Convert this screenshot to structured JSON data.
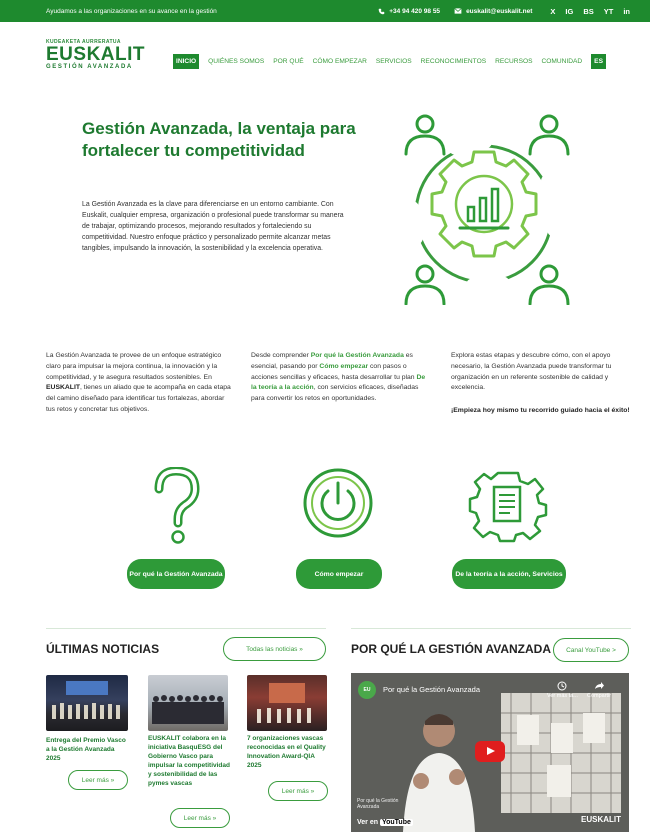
{
  "topbar": {
    "tagline": "Ayudamos a las organizaciones en su avance en la gestión",
    "phone": "+34 94 420 98 55",
    "email": "euskalit@euskalit.net",
    "socials": [
      "X",
      "IG",
      "BS",
      "YT",
      "in"
    ]
  },
  "logo": {
    "line1": "KUDEAKETA AURRERATUA",
    "line2": "EUSKALIT",
    "line3": "GESTIÓN AVANZADA"
  },
  "nav": {
    "items": [
      "INICIO",
      "QUIÉNES SOMOS",
      "POR QUÉ",
      "CÓMO EMPEZAR",
      "SERVICIOS",
      "RECONOCIMIENTOS",
      "RECURSOS",
      "COMUNIDAD"
    ],
    "lang": "ES"
  },
  "hero": {
    "title": "Gestión Avanzada, la ventaja para fortalecer tu competitividad",
    "text": "La Gestión Avanzada es la clave para diferenciarse en un entorno cambiante. Con Euskalit, cualquier empresa, organización o profesional puede transformar su manera de trabajar, optimizando procesos, mejorando resultados y fortaleciendo su competitividad. Nuestro enfoque práctico y personalizado permite alcanzar metas tangibles, impulsando la innovación, la sostenibilidad y la excelencia operativa."
  },
  "columns": {
    "c1_a": "La Gestión Avanzada te provee de un enfoque estratégico claro para impulsar la mejora continua, la innovación y la competitividad, y te asegura resultados sostenibles. En ",
    "c1_b": "EUSKALIT",
    "c1_c": ", tienes un aliado que te acompaña en cada etapa del camino diseñado para identificar tus fortalezas, abordar tus retos y concretar tus objetivos.",
    "c2_a": "Desde comprender ",
    "c2_b": "Por qué la Gestión Avanzada",
    "c2_c": " es esencial, pasando por ",
    "c2_d": "Cómo empezar",
    "c2_e": " con pasos o acciones sencillas y eficaces, hasta desarrollar tu plan ",
    "c2_f": "De la teoría a la acción",
    "c2_g": ", con servicios eficaces, diseñadas para convertir los retos en oportunidades.",
    "c3_a": "Explora estas etapas y descubre cómo, con el apoyo necesario, la Gestión Avanzada puede transformar tu organización en un referente sostenible de calidad y excelencia.",
    "c3_b": "¡Empieza hoy mismo tu recorrido guiado hacia el éxito!"
  },
  "features": [
    {
      "label": "Por qué la Gestión Avanzada",
      "icon": "question-icon"
    },
    {
      "label": "Cómo empezar",
      "icon": "power-icon"
    },
    {
      "label": "De la teoría a la acción, Servicios",
      "icon": "document-gear-icon"
    }
  ],
  "news": {
    "title": "ÚLTIMAS NOTICIAS",
    "all_label": "Todas las noticias »",
    "read_more": "Leer más »",
    "items": [
      "Entrega del Premio Vasco a la Gestión Avanzada 2025",
      "EUSKALIT colabora en la iniciativa BasquESG del Gobierno Vasco para impulsar la competitividad y sostenibilidad de las pymes vascas",
      "7 organizaciones vascas reconocidas en el Quality Innovation Award-QIA 2025"
    ]
  },
  "video": {
    "section_title": "POR QUÉ LA GESTIÓN AVANZADA",
    "channel_label": "Canal YouTube >",
    "title": "Por qué la Gestión Avanzada",
    "watch_later": "Ver más ta...",
    "share": "Compartir",
    "watch_on": "Ver en",
    "youtube": "YouTube",
    "brand": "EUSKALIT",
    "caption": "Por qué la Gestión Avanzada"
  },
  "colors": {
    "brand_green": "#1e8a2e",
    "accent_green": "#3a9c3e",
    "light_green": "#7cc54a"
  }
}
